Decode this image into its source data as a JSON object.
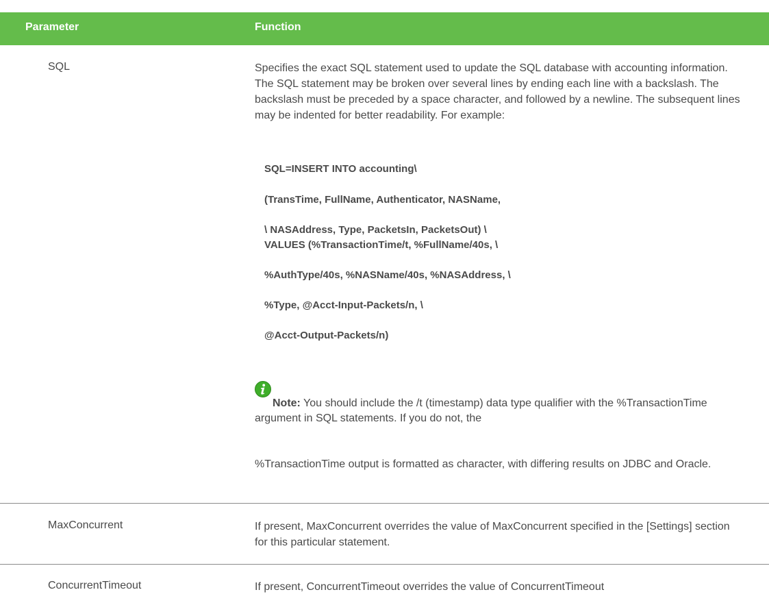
{
  "header": {
    "col_parameter": "Parameter",
    "col_function": "Function"
  },
  "rows": [
    {
      "parameter": "SQL",
      "function": "Specifies the exact SQL statement used to update the SQL database with accounting information. The SQL statement may be broken over several lines by ending each line with a backslash. The backslash must be preceded by a space character, and followed by a newline. The subsequent lines may be indented for better readability. For example:",
      "code_lines": [
        "SQL=INSERT INTO accounting\\",
        "(TransTime, FullName, Authenticator, NASName,",
        "\\ NASAddress, Type, PacketsIn, PacketsOut) \\",
        "VALUES (%TransactionTime/t, %FullName/40s, \\",
        "%AuthType/40s, %NASName/40s, %NASAddress, \\",
        "%Type, @Acct-Input-Packets/n, \\",
        "@Acct-Output-Packets/n)"
      ],
      "note_label": "Note:",
      "note_text": " You should include the /t (timestamp) data type qualifier with  the %TransactionTime argument in SQL statements. If you do not, the",
      "note_continued": "%TransactionTime output is formatted as character, with differing results on JDBC and Oracle."
    },
    {
      "parameter": "MaxConcurrent",
      "function": "If present, MaxConcurrent overrides the value of MaxConcurrent specified in the [Settings] section for this particular statement."
    },
    {
      "parameter": "ConcurrentTimeout",
      "function": "If present, ConcurrentTimeout overrides the value of ConcurrentTimeout"
    }
  ],
  "colors": {
    "header_bg": "#64bc4b",
    "note_icon": "#3fae2a",
    "text": "#4a4a4a"
  },
  "icons": {
    "note": "info-icon"
  }
}
